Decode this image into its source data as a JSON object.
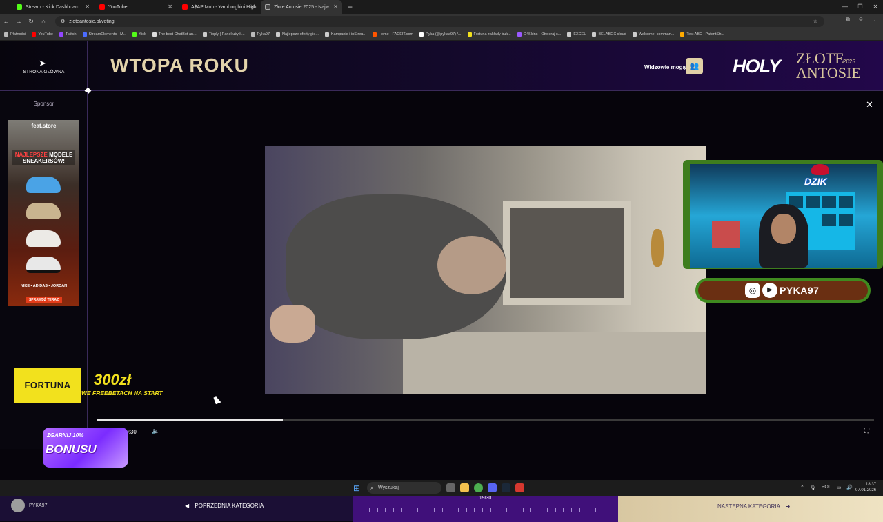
{
  "browser": {
    "tabs": [
      {
        "title": "Stream - Kick Dashboard",
        "color": "#53fc18"
      },
      {
        "title": "YouTube",
        "color": "#ff0000"
      },
      {
        "title": "A$AP Mob - Yamborghini High",
        "color": "#ff0000"
      },
      {
        "title": "Złote Antosie 2025 - Najw...",
        "color": "#ffffff"
      }
    ],
    "url": "zloteantosie.pl/voting",
    "bookmarks": [
      {
        "label": "Płatności",
        "color": "#bbbbbb"
      },
      {
        "label": "YouTube",
        "color": "#ff0000"
      },
      {
        "label": "Twitch",
        "color": "#9146ff"
      },
      {
        "label": "StreamElements - M...",
        "color": "#4b6cff"
      },
      {
        "label": "Kick",
        "color": "#53fc18"
      },
      {
        "label": "The best ChatBot an...",
        "color": "#dddddd"
      },
      {
        "label": "Tipply | Panel użytk...",
        "color": "#cccccc"
      },
      {
        "label": "Pyka97",
        "color": "#bbbbbb"
      },
      {
        "label": "Najlepsze oferty gie...",
        "color": "#cccccc"
      },
      {
        "label": "Kampanie i inStrea...",
        "color": "#cccccc"
      },
      {
        "label": "Home - FACEIT.com",
        "color": "#ff5500"
      },
      {
        "label": "Pyka (@pykaa97) /...",
        "color": "#ffffff"
      },
      {
        "label": "Fortuna zakłady buk...",
        "color": "#f2e11d"
      },
      {
        "label": "G4Skins - Otwieraj s...",
        "color": "#9b59ff"
      },
      {
        "label": "EXCEL",
        "color": "#cccccc"
      },
      {
        "label": "BELABOX cloud",
        "color": "#cccccc"
      },
      {
        "label": "Welcome, comman...",
        "color": "#cccccc"
      },
      {
        "label": "Test ABC | PatentStr...",
        "color": "#ffaa00"
      }
    ]
  },
  "header": {
    "home_label": "STRONA GŁÓWNA",
    "category_title": "WTOPA ROKU",
    "viewers_label": "Widzowie mogą",
    "logo_holy": "HOLY",
    "logo_zlote": "ZŁOTE",
    "logo_antosie": "ANTOSIE",
    "logo_year": "2025"
  },
  "sidebar": {
    "sponsor_label": "Sponsor",
    "ad_brand": "feat.store",
    "ad_headline_1": "NAJLEPSZE",
    "ad_headline_2": "MODELE",
    "ad_headline_3": "SNEAKERSÓW!",
    "ad_brands": "NIKE • ADIDAS • JORDAN",
    "ad_cta": "SPRAWDŹ TERAZ"
  },
  "fortuna": {
    "brand": "FORTUNA",
    "amount": "300zł",
    "subtitle": "WE FREEBETACH NA START"
  },
  "player": {
    "time": "0:07 / 0:30",
    "progress": 0.24
  },
  "overlay": {
    "handle": "PYKA97",
    "badge": "DZIK",
    "bonus_top": "ZGARNIJ 10%",
    "bonus_main": "BONUSU"
  },
  "bottom_nav": {
    "user_name": "PYKA97",
    "prev_label": "POPRZEDNIA KATEGORIA",
    "counter": "19/30",
    "current": 19,
    "total": 30,
    "next_label": "NASTĘPNA KATEGORIA"
  },
  "taskbar": {
    "search_placeholder": "Wyszukaj",
    "lang": "POL",
    "time": "18:37",
    "date": "07.01.2026"
  },
  "colors": {
    "accent_gold": "#e3d3aa",
    "purple": "#40107a",
    "fortuna_yellow": "#f2e11d"
  }
}
